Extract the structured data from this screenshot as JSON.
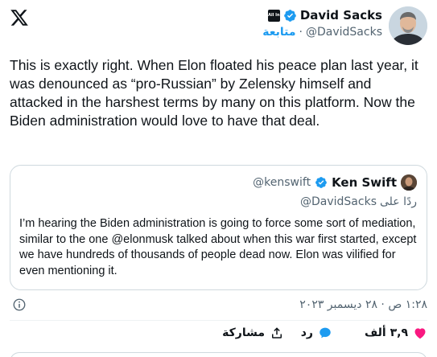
{
  "author": {
    "display_name": "David Sacks",
    "handle": "@DavidSacks",
    "follow_label": "متابعة",
    "separator": "·",
    "affiliate_badge_text": "All In"
  },
  "tweet": {
    "text": "This is exactly right. When Elon floated his peace plan last year, it was denounced as “pro-Russian” by Zelensky himself and attacked in the harshest terms by many on this platform. Now the Biden administration would love to have that deal."
  },
  "quote": {
    "display_name": "Ken Swift",
    "handle": "@kenswift",
    "reply_prefix": "ردًا على",
    "reply_handle": "@DavidSacks",
    "text": "I’m hearing the Biden administration is going to force some sort of mediation, similar to the one @elonmusk talked about when this war first started, except we have hundreds of thousands of people dead now. Elon was vilified for even mentioning it."
  },
  "timestamp": "١:٢٨ ص · ٢٨ ديسمبر ٢٠٢٣",
  "actions": {
    "like_count": "٣,٩ ألف",
    "reply_label": "رد",
    "share_label": "مشاركة"
  },
  "colors": {
    "accent": "#1d9bf0",
    "like": "#f91880",
    "text": "#0f1419",
    "secondary": "#536471"
  },
  "icons": [
    "x-logo-icon",
    "verified-badge-icon",
    "affiliate-badge-icon",
    "info-icon",
    "heart-icon",
    "reply-bubble-icon",
    "share-icon"
  ]
}
